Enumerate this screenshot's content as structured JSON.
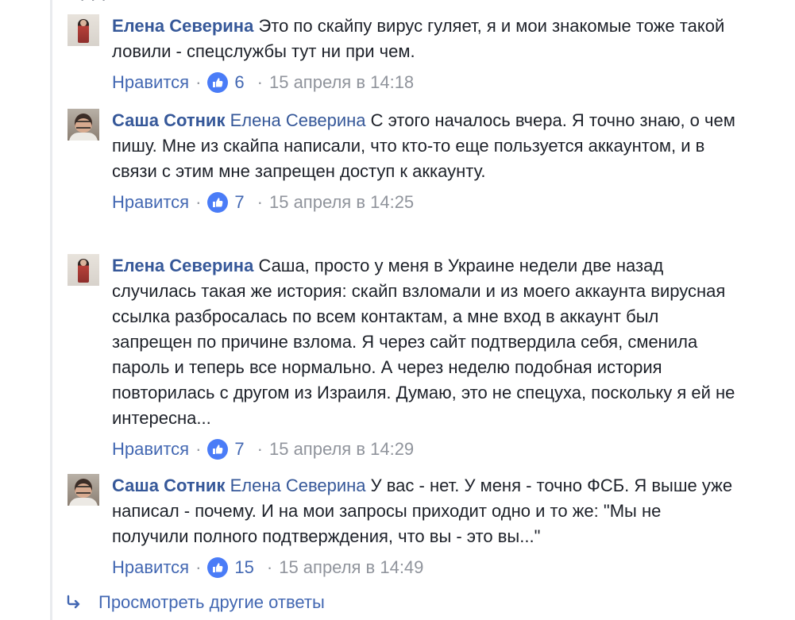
{
  "comments": [
    {
      "author": "Елена Северина",
      "mention": "",
      "text": "Это по скайпу вирус гуляет, я и мои знакомые тоже такой ловили - спецслужбы тут ни при чем.",
      "like_label": "Нравится",
      "like_count": "6",
      "timestamp": "15 апреля в 14:18"
    },
    {
      "author": "Саша Сотник",
      "mention": "Елена Северина",
      "text": "С этого началось вчера. Я точно знаю, о чем пишу. Мне из скайпа написали, что кто-то еще пользуется аккаунтом, и в связи с этим мне запрещен доступ к аккаунту.",
      "like_label": "Нравится",
      "like_count": "7",
      "timestamp": "15 апреля в 14:25"
    },
    {
      "author": "Елена Северина",
      "mention": "",
      "text": "Саша, просто у меня в Украине недели две назад случилась такая же история: скайп взломали и из моего аккаунта вирусная ссылка разбросалась по всем контактам, а мне вход в аккаунт был запрещен по причине взлома. Я через сайт подтвердила себя, сменила пароль и теперь все нормально. А через неделю подобная история повторилась с другом из Израиля. Думаю, это не спецуха, поскольку я ей не интересна...",
      "like_label": "Нравится",
      "like_count": "7",
      "timestamp": "15 апреля в 14:29"
    },
    {
      "author": "Саша Сотник",
      "mention": "Елена Северина",
      "text": "У вас - нет. У меня - точно ФСБ. Я выше уже написал - почему. И на мои запросы приходит одно и то же: \"Мы не получили полного подтверждения, что вы - это вы...\"",
      "like_label": "Нравится",
      "like_count": "15",
      "timestamp": "15 апреля в 14:49"
    }
  ],
  "footer": {
    "more_replies": "Просмотреть другие ответы"
  },
  "icons": {
    "like": "thumbs-up-icon",
    "reply": "reply-arrow-icon"
  },
  "colors": {
    "link": "#365899",
    "reaction_blue": "#4a7cf7",
    "meta_gray": "#90949c"
  }
}
